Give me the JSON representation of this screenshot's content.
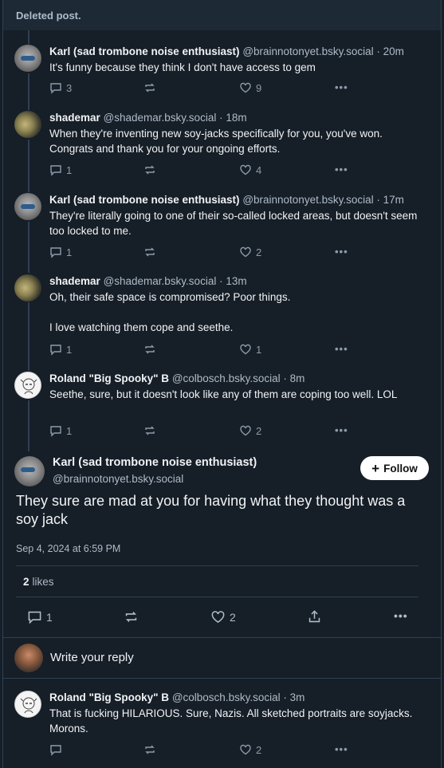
{
  "deleted_label": "Deleted post.",
  "thread": [
    {
      "author": "Karl (sad trombone noise enthusiast)",
      "handle": "@brainnotonyet.bsky.social",
      "time": "20m",
      "text": "It's funny because they think I don't have access to gem",
      "replies": "3",
      "reposts": "",
      "likes": "9",
      "avatar": "karl"
    },
    {
      "author": "shademar",
      "handle": "@shademar.bsky.social",
      "time": "18m",
      "text": "When they're inventing new soy-jacks specifically for you, you've won. Congrats and thank you for your ongoing efforts.",
      "replies": "1",
      "reposts": "",
      "likes": "4",
      "avatar": "shade"
    },
    {
      "author": "Karl (sad trombone noise enthusiast)",
      "handle": "@brainnotonyet.bsky.social",
      "time": "17m",
      "text": "They're literally going to one of their so-called locked areas, but doesn't seem too locked to me.",
      "replies": "1",
      "reposts": "",
      "likes": "2",
      "avatar": "karl"
    },
    {
      "author": "shademar",
      "handle": "@shademar.bsky.social",
      "time": "13m",
      "text": "Oh, their safe space is compromised? Poor things.\n\nI love watching them cope and seethe.",
      "replies": "1",
      "reposts": "",
      "likes": "1",
      "avatar": "shade"
    },
    {
      "author": "Roland \"Big Spooky\" B",
      "handle": "@colbosch.bsky.social",
      "time": "8m",
      "text": "Seethe, sure, but it doesn't look like any of them are coping too well. LOL",
      "replies": "1",
      "reposts": "",
      "likes": "2",
      "avatar": "roland"
    }
  ],
  "main_post": {
    "author": "Karl (sad trombone noise enthusiast)",
    "handle": "@brainnotonyet.bsky.social",
    "follow_label": "Follow",
    "text": "They sure are mad at you for having what they thought was a soy jack",
    "timestamp": "Sep 4, 2024 at 6:59 PM",
    "likes_count": "2",
    "likes_label": "likes",
    "replies": "1",
    "likes": "2"
  },
  "reply_prompt": "Write your reply",
  "reply": {
    "author": "Roland \"Big Spooky\" B",
    "handle": "@colbosch.bsky.social",
    "time": "3m",
    "text": "That is fucking HILARIOUS. Sure, Nazis. All sketched portraits are soyjacks. Morons.",
    "replies": "",
    "reposts": "",
    "likes": "2"
  },
  "colors": {
    "background": "#161e27",
    "border": "#2e4052",
    "muted": "#aebbc9"
  }
}
